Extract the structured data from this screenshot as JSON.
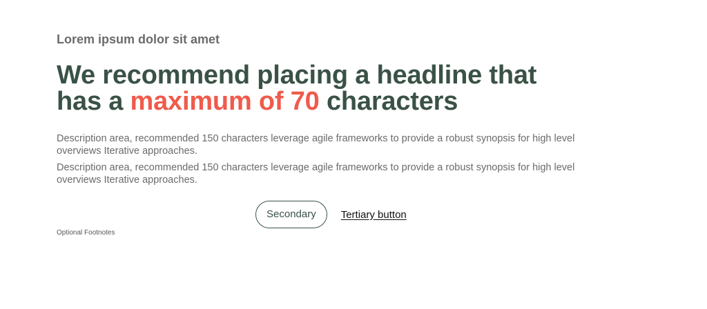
{
  "hero": {
    "eyebrow": "Lorem ipsum dolor sit amet",
    "headline_before": "We recommend placing a headline that has a ",
    "headline_accent": "maximum of 70",
    "headline_after": " characters",
    "descriptions": [
      "Description area, recommended 150 characters leverage agile frameworks to provide a robust synopsis for high level overviews Iterative approaches.",
      "Description area, recommended 150 characters leverage agile frameworks to provide a robust synopsis for high level overviews Iterative approaches."
    ]
  },
  "actions": {
    "secondary_label": "Secondary",
    "tertiary_label": "Tertiary button"
  },
  "footnote": "Optional Footnotes",
  "colors": {
    "headline": "#3a5246",
    "accent": "#ef5b4c",
    "body_text": "#6a6a6a"
  }
}
